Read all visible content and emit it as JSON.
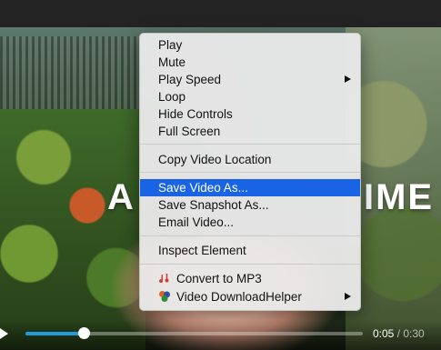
{
  "video": {
    "overlay_left": "A",
    "overlay_right": "IME"
  },
  "player": {
    "current_time": "0:05",
    "duration": "0:30",
    "progress_fraction": 0.173
  },
  "menu": {
    "items": [
      {
        "label": "Play"
      },
      {
        "label": "Mute"
      },
      {
        "label": "Play Speed",
        "submenu": true
      },
      {
        "label": "Loop"
      },
      {
        "label": "Hide Controls"
      },
      {
        "label": "Full Screen"
      },
      {
        "label": "Copy Video Location"
      },
      {
        "label": "Save Video As...",
        "selected": true
      },
      {
        "label": "Save Snapshot As..."
      },
      {
        "label": "Email Video..."
      },
      {
        "label": "Inspect Element"
      },
      {
        "label": "Convert to MP3",
        "icon": "music-note-icon"
      },
      {
        "label": "Video DownloadHelper",
        "icon": "downloadhelper-icon",
        "submenu": true
      }
    ]
  },
  "colors": {
    "selection": "#1864e5",
    "progress": "#1f9bde"
  }
}
